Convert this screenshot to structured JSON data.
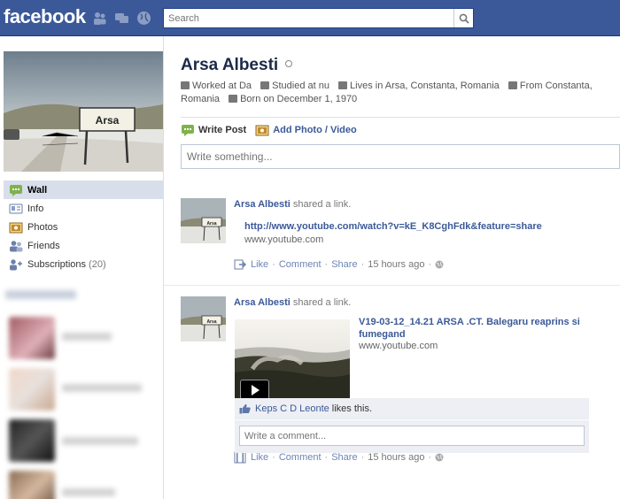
{
  "header": {
    "logo": "facebook",
    "search_placeholder": "Search"
  },
  "sidebar": {
    "sign_text": "Arsa",
    "nav": [
      {
        "label": "Wall",
        "icon": "wall-icon",
        "active": true
      },
      {
        "label": "Info",
        "icon": "info-icon"
      },
      {
        "label": "Photos",
        "icon": "photos-icon"
      },
      {
        "label": "Friends",
        "icon": "friends-icon"
      },
      {
        "label": "Subscriptions",
        "count": "(20)",
        "icon": "subscriptions-icon"
      }
    ]
  },
  "profile": {
    "name": "Arsa Albesti",
    "worked_at": "Worked at Da",
    "studied_at": "Studied at nu",
    "lives_in": "Lives in Arsa, Constanta, Romania",
    "from": "From Constanta,",
    "from_cont": "Romania",
    "born": "Born on December 1, 1970"
  },
  "composer": {
    "write_post": "Write Post",
    "add_photo": "Add Photo / Video",
    "placeholder": "Write something..."
  },
  "posts": [
    {
      "author": "Arsa Albesti",
      "action": "shared a link.",
      "thumb_sign": "Arsa",
      "url": "http://www.youtube.com/watch?v=kE_K8CghFdk&feature=share",
      "source": "www.youtube.com",
      "like": "Like",
      "comment": "Comment",
      "share": "Share",
      "time": "15 hours ago"
    },
    {
      "author": "Arsa Albesti",
      "action": "shared a link.",
      "thumb_sign": "Arsa",
      "video_title": "V19-03-12_14.21 ARSA .CT. Balegaru reaprins si fumegand",
      "source": "www.youtube.com",
      "like": "Like",
      "comment": "Comment",
      "share": "Share",
      "time": "15 hours ago",
      "liker": "Keps C D Leonte",
      "likes_suffix": "likes this.",
      "comment_placeholder": "Write a comment..."
    }
  ],
  "colors": {
    "brand": "#3b5998",
    "link": "#3b5998",
    "nav_active": "#d8dfea"
  }
}
